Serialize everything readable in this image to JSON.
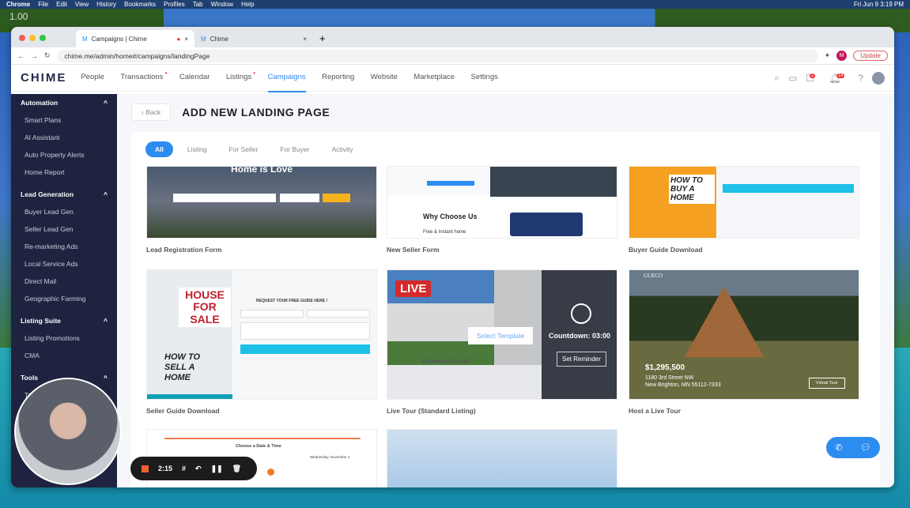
{
  "os_menu": {
    "items": [
      "Chrome",
      "File",
      "Edit",
      "View",
      "History",
      "Bookmarks",
      "Profiles",
      "Tab",
      "Window",
      "Help"
    ],
    "clock": "Fri Jun 9  3:19 PM"
  },
  "zoom_label": "1.00",
  "browser": {
    "tabs": [
      {
        "label": "Campaigns | Chime"
      },
      {
        "label": "Chime"
      }
    ],
    "url": "chime.me/admin/home#/campaigns/landingPage",
    "update": "Update"
  },
  "app": {
    "logo": "CHIME",
    "nav": [
      "People",
      "Transactions",
      "Calendar",
      "Listings",
      "Campaigns",
      "Reporting",
      "Website",
      "Marketplace",
      "Settings"
    ],
    "active_nav": "Campaigns",
    "badges": {
      "tasks": "2",
      "notifications": "14"
    }
  },
  "sidebar": {
    "sections": [
      {
        "title": "Automation",
        "items": [
          "Smart Plans",
          "AI Assistant",
          "Auto Property Alerts",
          "Home Report"
        ]
      },
      {
        "title": "Lead Generation",
        "items": [
          "Buyer Lead Gen",
          "Seller Lead Gen",
          "Re-marketing Ads",
          "Local Service Ads",
          "Direct Mail",
          "Geographic Farming"
        ]
      },
      {
        "title": "Listing Suite",
        "items": [
          "Listing Promotions",
          "CMA"
        ]
      },
      {
        "title": "Tools",
        "items": [
          "Te..."
        ]
      }
    ]
  },
  "page": {
    "back": "Back",
    "title": "ADD NEW LANDING PAGE",
    "filters": [
      "All",
      "Listing",
      "For Seller",
      "For Buyer",
      "Activity"
    ],
    "active_filter": "All"
  },
  "templates": [
    {
      "name": "Lead Registration Form",
      "thumb_text": "Home is Love"
    },
    {
      "name": "New Seller Form",
      "thumb_text": "Why Choose Us",
      "thumb_sub": "Free & Instant home"
    },
    {
      "name": "Buyer Guide Download",
      "thumb_text": "HOW TO BUY A HOME"
    },
    {
      "name": "Seller Guide Download",
      "thumb_text": "HOUSE FOR SALE",
      "thumb_sub": "HOW TO SELL A HOME",
      "form_text": "REQUEST YOUR FREE GUIDE HERE !"
    },
    {
      "name": "Live Tour (Standard Listing)",
      "live": "LIVE",
      "select": "Select Template",
      "countdown": "Countdown: 03:00",
      "reminder": "Set Reminder",
      "address": "826 Marino Pines RD"
    },
    {
      "name": "Host a Live Tour",
      "price": "$1,295,500",
      "address1": "1180 3rd Street NW",
      "address2": "New Brighton, MN 55112-7333",
      "brand": "GUECO",
      "cta": "Virtual Tour"
    },
    {
      "name": "",
      "thumb_text": "Choose a Date & Time",
      "thumb_sub": "Wednesday, November 2"
    },
    {
      "name": ""
    }
  ],
  "recorder": {
    "time": "2:15"
  }
}
